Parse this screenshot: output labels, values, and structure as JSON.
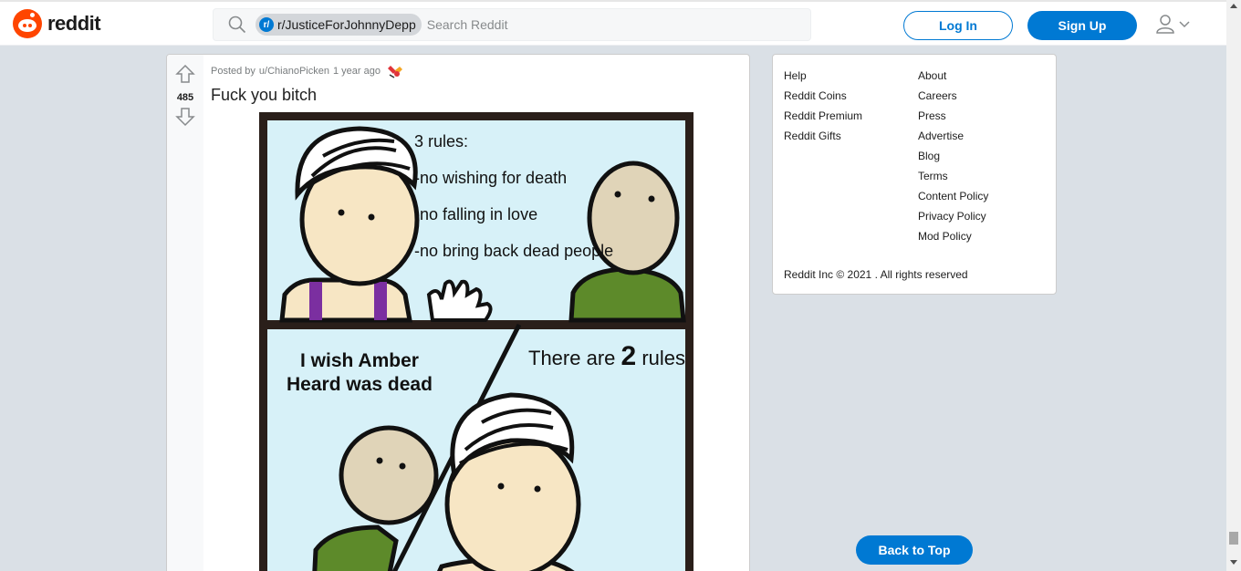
{
  "header": {
    "logo_text": "reddit",
    "search": {
      "chip_label": "r/JusticeForJohnnyDepp",
      "placeholder": "Search Reddit"
    },
    "login_label": "Log In",
    "signup_label": "Sign Up"
  },
  "post": {
    "votes": "485",
    "posted_by_prefix": "Posted by",
    "author": "u/ChianoPicken",
    "time": "1 year ago",
    "title": "Fuck you bitch",
    "comic": {
      "panel1_rules_title": "3 rules:",
      "panel1_rule1": "-no wishing for death",
      "panel1_rule2": "-no falling in love",
      "panel1_rule3": "-no bring back dead people",
      "panel2_wish_line1": "I wish Amber",
      "panel2_wish_line2": "Heard was dead",
      "panel2_rules_prefix": "There are",
      "panel2_rules_num": "2",
      "panel2_rules_suffix": "rules"
    }
  },
  "sidebar": {
    "col1": [
      "Help",
      "Reddit Coins",
      "Reddit Premium",
      "Reddit Gifts"
    ],
    "col2": [
      "About",
      "Careers",
      "Press",
      "Advertise",
      "Blog",
      "Terms",
      "Content Policy",
      "Privacy Policy",
      "Mod Policy"
    ],
    "copyright": "Reddit Inc © 2021 . All rights reserved"
  },
  "back_to_top_label": "Back to Top",
  "colors": {
    "brand": "#ff4500",
    "accent": "#0079d3",
    "background": "#dae0e6"
  }
}
